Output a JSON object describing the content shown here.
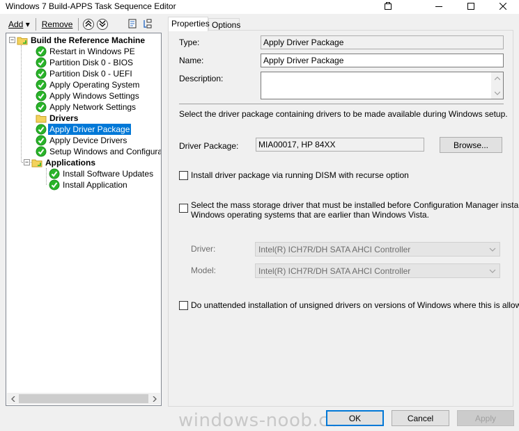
{
  "window": {
    "title": "Windows 7 Build-APPS Task Sequence Editor",
    "minimize_icon": "minimize-icon",
    "maximize_icon": "maximize-icon",
    "close_icon": "close-icon"
  },
  "toolbar": {
    "add_label": "Add",
    "remove_label": "Remove",
    "move_up_icon": "move-up-icon",
    "move_down_icon": "move-down-icon",
    "properties_icon": "properties-icon",
    "group_icon": "group-icon"
  },
  "tree": {
    "groups": [
      {
        "label": "Build the Reference Machine",
        "items": [
          {
            "label": "Restart in Windows PE"
          },
          {
            "label": "Partition Disk 0 - BIOS"
          },
          {
            "label": "Partition Disk 0 - UEFI"
          },
          {
            "label": "Apply Operating System"
          },
          {
            "label": "Apply Windows Settings"
          },
          {
            "label": "Apply Network Settings"
          },
          {
            "label": "Drivers",
            "group": true
          },
          {
            "label": "Apply Driver Package",
            "selected": true
          },
          {
            "label": "Apply Device Drivers"
          },
          {
            "label": "Setup Windows and Configuration Manager"
          }
        ]
      },
      {
        "label": "Applications",
        "items": [
          {
            "label": "Install Software Updates"
          },
          {
            "label": "Install Application"
          }
        ]
      }
    ],
    "selected_color": "#0078d7"
  },
  "tabs": [
    {
      "label": "Properties",
      "active": true
    },
    {
      "label": "Options",
      "active": false
    }
  ],
  "properties": {
    "type_label": "Type:",
    "type_value": "Apply Driver Package",
    "name_label": "Name:",
    "name_value": "Apply Driver Package",
    "description_label": "Description:",
    "description_value": "",
    "instruction": "Select the driver package containing drivers to be made available during Windows setup.",
    "driver_package_label": "Driver Package:",
    "driver_package_value": "MIA00017, HP 84XX",
    "browse_label": "Browse...",
    "dism_checkbox_label": "Install driver package via running DISM with recurse option",
    "mass_storage_label_line1": "Select the mass storage driver that must be installed before Configuration Manager installs",
    "mass_storage_label_line2": "Windows operating systems that are earlier than Windows Vista.",
    "driver_label": "Driver:",
    "driver_value": "Intel(R) ICH7R/DH SATA AHCI Controller",
    "model_label": "Model:",
    "model_value": "Intel(R) ICH7R/DH SATA AHCI Controller",
    "unsigned_label": "Do unattended installation of unsigned drivers on versions of Windows where this is allowed"
  },
  "buttons": {
    "ok": "OK",
    "cancel": "Cancel",
    "apply": "Apply"
  },
  "watermark": "windows-noob.com",
  "colors": {
    "success_green": "#29b429",
    "folder_yellow": "#f3d25c",
    "accent": "#0078d7"
  }
}
